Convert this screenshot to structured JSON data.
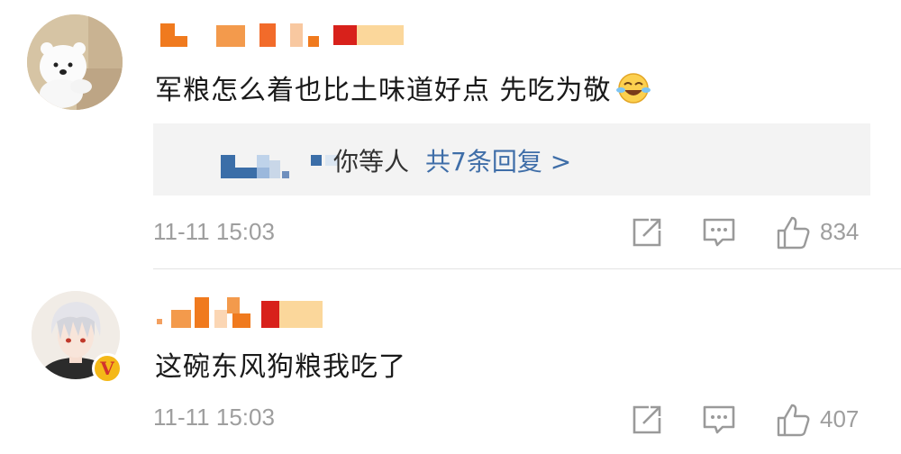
{
  "comments": [
    {
      "username": "",
      "avatar_icon": "polar-bear-avatar-icon",
      "text": "军粮怎么着也比土味道好点  先吃为敬",
      "emoji_icon": "laughing-tears-emoji-icon",
      "replies": {
        "names_suffix": "你等人",
        "more_label": "共7条回复 >"
      },
      "time": "11-11 15:03",
      "like_count": "834"
    },
    {
      "username": "",
      "avatar_icon": "anime-character-avatar-icon",
      "verified_badge": "V",
      "text": "这碗东风狗粮我吃了",
      "time": "11-11 15:03",
      "like_count": "407"
    }
  ],
  "actions": {
    "share_icon": "share-icon",
    "comment_icon": "comment-icon",
    "like_icon": "thumbs-up-icon"
  },
  "colors": {
    "link": "#3f6ea8",
    "meta_text": "#9e9e9e",
    "reply_bg": "#f3f3f3",
    "pixelated_orange": "#f07a1e",
    "pixelated_red": "#d8211b",
    "pixelated_blue": "#3b6ea8"
  }
}
